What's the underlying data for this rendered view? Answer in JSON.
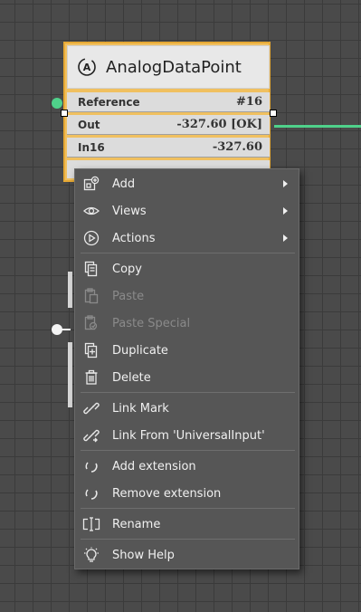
{
  "node": {
    "title": "AnalogDataPoint",
    "icon": "analog-a-icon",
    "slots": [
      {
        "label": "Reference",
        "value": "#16"
      },
      {
        "label": "Out",
        "value": "-327.60 [OK]"
      },
      {
        "label": "In16",
        "value": "-327.60"
      }
    ]
  },
  "colors": {
    "canvas": "#4a4a4a",
    "node_border": "#e6a935",
    "wire_green": "#4fd18a",
    "menu_bg": "#565656"
  },
  "menu": {
    "items": [
      {
        "label": "Add",
        "icon": "add-component-icon",
        "submenu": true,
        "disabled": false
      },
      {
        "label": "Views",
        "icon": "eye-icon",
        "submenu": true,
        "disabled": false
      },
      {
        "label": "Actions",
        "icon": "play-circle-icon",
        "submenu": true,
        "disabled": false
      },
      {
        "label": "Copy",
        "icon": "copy-icon",
        "submenu": false,
        "disabled": false
      },
      {
        "label": "Paste",
        "icon": "paste-icon",
        "submenu": false,
        "disabled": true
      },
      {
        "label": "Paste Special",
        "icon": "paste-special-icon",
        "submenu": false,
        "disabled": true
      },
      {
        "label": "Duplicate",
        "icon": "duplicate-icon",
        "submenu": false,
        "disabled": false
      },
      {
        "label": "Delete",
        "icon": "trash-icon",
        "submenu": false,
        "disabled": false
      },
      {
        "label": "Link Mark",
        "icon": "link-icon",
        "submenu": false,
        "disabled": false
      },
      {
        "label": "Link From 'UniversalInput'",
        "icon": "link-from-icon",
        "submenu": false,
        "disabled": false
      },
      {
        "label": "Add extension",
        "icon": "extension-icon",
        "submenu": false,
        "disabled": false
      },
      {
        "label": "Remove extension",
        "icon": "extension-icon",
        "submenu": false,
        "disabled": false
      },
      {
        "label": "Rename",
        "icon": "rename-icon",
        "submenu": false,
        "disabled": false
      },
      {
        "label": "Show Help",
        "icon": "help-bulb-icon",
        "submenu": false,
        "disabled": false
      }
    ]
  }
}
